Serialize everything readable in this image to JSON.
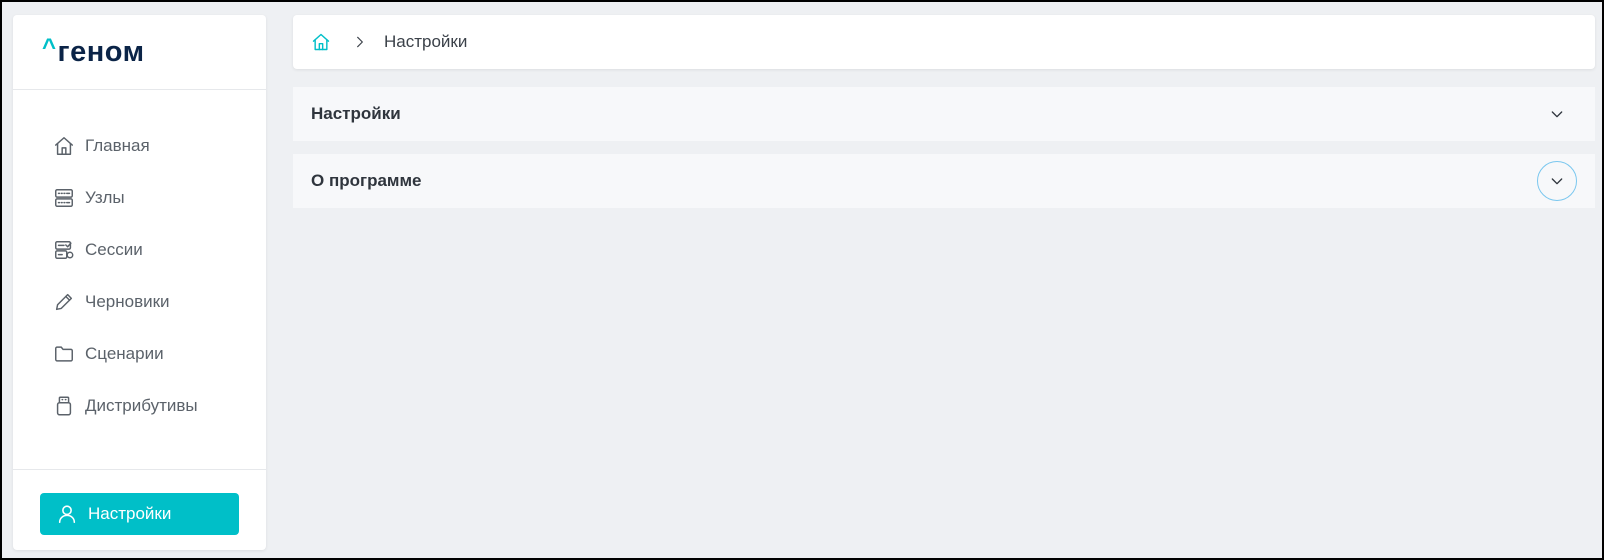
{
  "brand": {
    "logo_text": "геном",
    "accent": "#00bfc8",
    "logo_color": "#0b2447"
  },
  "sidebar": {
    "items": [
      {
        "label": "Главная",
        "icon": "home-icon"
      },
      {
        "label": "Узлы",
        "icon": "server-icon"
      },
      {
        "label": "Сессии",
        "icon": "sessions-icon"
      },
      {
        "label": "Черновики",
        "icon": "pencil-icon"
      },
      {
        "label": "Сценарии",
        "icon": "folder-icon"
      },
      {
        "label": "Дистрибутивы",
        "icon": "usb-drive-icon"
      }
    ],
    "footer_button": {
      "label": "Настройки",
      "icon": "user-icon",
      "active": true
    }
  },
  "breadcrumb": {
    "home_icon": "home-icon",
    "separator_icon": "chevron-right-icon",
    "current": "Настройки"
  },
  "sections": [
    {
      "title": "Настройки",
      "expanded": false
    },
    {
      "title": "О программе",
      "expanded": false,
      "focused": true
    }
  ]
}
